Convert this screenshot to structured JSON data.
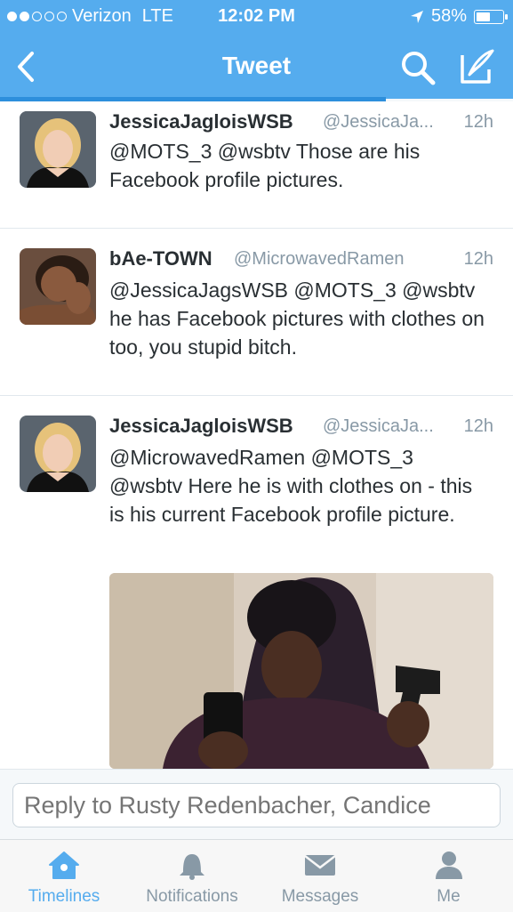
{
  "status_bar": {
    "carrier": "Verizon",
    "network": "LTE",
    "time": "12:02 PM",
    "battery": "58%",
    "battery_level": 0.58,
    "signal_dots_filled": 2,
    "signal_dots_total": 5
  },
  "nav": {
    "title": "Tweet",
    "back_icon": "chevron-left-icon",
    "search_icon": "search-icon",
    "compose_icon": "compose-icon"
  },
  "tweets": [
    {
      "name": "JessicaJagloisWSB",
      "handle": "@JessicaJa...",
      "time": "12h",
      "text": "@MOTS_3 @wsbtv Those are his Facebook profile pictures."
    },
    {
      "name": "bAe-TOWN",
      "handle": "@MicrowavedRamen",
      "time": "12h",
      "text": "@JessicaJagsWSB @MOTS_3 @wsbtv he has Facebook pictures with clothes on too, you stupid bitch."
    },
    {
      "name": "JessicaJagloisWSB",
      "handle": "@JessicaJa...",
      "time": "12h",
      "text": "@MicrowavedRamen @MOTS_3 @wsbtv Here he is with clothes on - this is his current Facebook profile picture."
    }
  ],
  "reply": {
    "placeholder": "Reply to Rusty Redenbacher, Candice"
  },
  "tabs": [
    {
      "label": "Timelines",
      "icon": "home-icon",
      "active": true
    },
    {
      "label": "Notifications",
      "icon": "bell-icon",
      "active": false
    },
    {
      "label": "Messages",
      "icon": "envelope-icon",
      "active": false
    },
    {
      "label": "Me",
      "icon": "person-icon",
      "active": false
    }
  ],
  "colors": {
    "brand": "#55acee",
    "text": "#292f33",
    "muted": "#8899a6"
  }
}
